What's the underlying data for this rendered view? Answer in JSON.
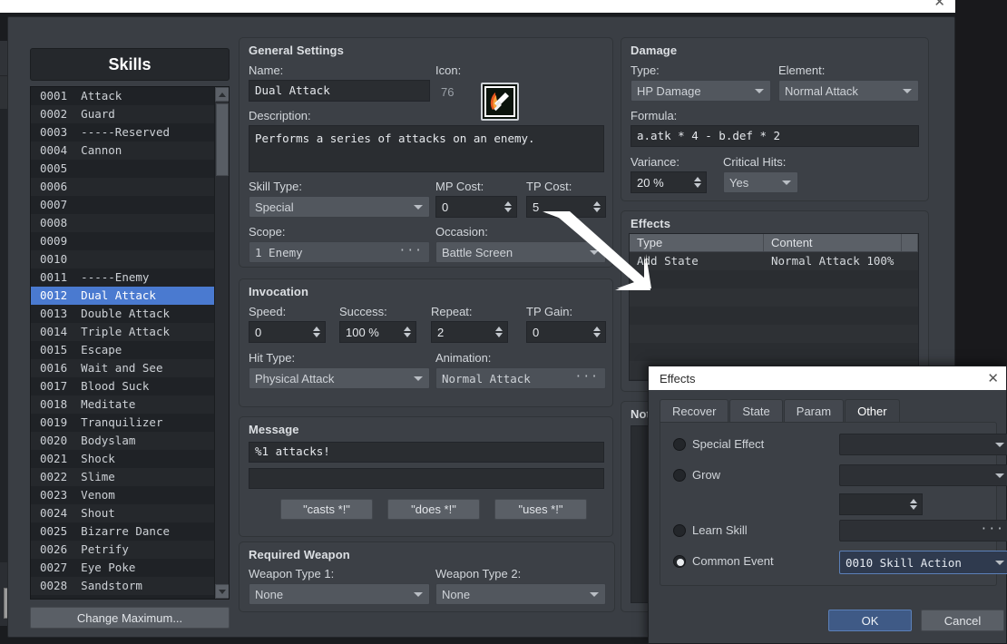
{
  "window": {
    "title_close": "✕",
    "skills_header": "Skills",
    "change_maximum": "Change Maximum..."
  },
  "skill_list": [
    {
      "id": "0001",
      "name": "Attack",
      "selected": false
    },
    {
      "id": "0002",
      "name": "Guard",
      "selected": false
    },
    {
      "id": "0003",
      "name": "-----Reserved",
      "selected": false
    },
    {
      "id": "0004",
      "name": "Cannon",
      "selected": false
    },
    {
      "id": "0005",
      "name": "",
      "selected": false
    },
    {
      "id": "0006",
      "name": "",
      "selected": false
    },
    {
      "id": "0007",
      "name": "",
      "selected": false
    },
    {
      "id": "0008",
      "name": "",
      "selected": false
    },
    {
      "id": "0009",
      "name": "",
      "selected": false
    },
    {
      "id": "0010",
      "name": "",
      "selected": false
    },
    {
      "id": "0011",
      "name": "-----Enemy",
      "selected": false
    },
    {
      "id": "0012",
      "name": "Dual Attack",
      "selected": true
    },
    {
      "id": "0013",
      "name": "Double Attack",
      "selected": false
    },
    {
      "id": "0014",
      "name": "Triple Attack",
      "selected": false
    },
    {
      "id": "0015",
      "name": "Escape",
      "selected": false
    },
    {
      "id": "0016",
      "name": "Wait and See",
      "selected": false
    },
    {
      "id": "0017",
      "name": "Blood Suck",
      "selected": false
    },
    {
      "id": "0018",
      "name": "Meditate",
      "selected": false
    },
    {
      "id": "0019",
      "name": "Tranquilizer",
      "selected": false
    },
    {
      "id": "0020",
      "name": "Bodyslam",
      "selected": false
    },
    {
      "id": "0021",
      "name": "Shock",
      "selected": false
    },
    {
      "id": "0022",
      "name": "Slime",
      "selected": false
    },
    {
      "id": "0023",
      "name": "Venom",
      "selected": false
    },
    {
      "id": "0024",
      "name": "Shout",
      "selected": false
    },
    {
      "id": "0025",
      "name": "Bizarre Dance",
      "selected": false
    },
    {
      "id": "0026",
      "name": "Petrify",
      "selected": false
    },
    {
      "id": "0027",
      "name": "Eye Poke",
      "selected": false
    },
    {
      "id": "0028",
      "name": "Sandstorm",
      "selected": false
    }
  ],
  "general": {
    "title": "General Settings",
    "name_label": "Name:",
    "name_value": "Dual Attack",
    "icon_label": "Icon:",
    "icon_index": "76",
    "description_label": "Description:",
    "description_value": "Performs a series of attacks on an enemy.",
    "skill_type_label": "Skill Type:",
    "skill_type_value": "Special",
    "mp_cost_label": "MP Cost:",
    "mp_cost_value": "0",
    "tp_cost_label": "TP Cost:",
    "tp_cost_value": "5",
    "scope_label": "Scope:",
    "scope_value": "1 Enemy",
    "occasion_label": "Occasion:",
    "occasion_value": "Battle Screen"
  },
  "invocation": {
    "title": "Invocation",
    "speed_label": "Speed:",
    "speed_value": "0",
    "success_label": "Success:",
    "success_value": "100 %",
    "repeat_label": "Repeat:",
    "repeat_value": "2",
    "tp_gain_label": "TP Gain:",
    "tp_gain_value": "0",
    "hit_type_label": "Hit Type:",
    "hit_type_value": "Physical Attack",
    "animation_label": "Animation:",
    "animation_value": "Normal Attack"
  },
  "message": {
    "title": "Message",
    "line1": "%1 attacks!",
    "line2": "",
    "preset1": "\"casts *!\"",
    "preset2": "\"does *!\"",
    "preset3": "\"uses *!\""
  },
  "required_weapon": {
    "title": "Required Weapon",
    "type1_label": "Weapon Type 1:",
    "type1_value": "None",
    "type2_label": "Weapon Type 2:",
    "type2_value": "None"
  },
  "damage": {
    "title": "Damage",
    "type_label": "Type:",
    "type_value": "HP Damage",
    "element_label": "Element:",
    "element_value": "Normal Attack",
    "formula_label": "Formula:",
    "formula_value": "a.atk * 4 - b.def * 2",
    "variance_label": "Variance:",
    "variance_value": "20 %",
    "critical_label": "Critical Hits:",
    "critical_value": "Yes"
  },
  "effects_panel": {
    "title": "Effects",
    "columns": [
      "Type",
      "Content",
      ""
    ],
    "rows": [
      [
        "Add State",
        "Normal Attack 100%"
      ]
    ]
  },
  "note_panel": {
    "title": "Note"
  },
  "effects_dialog": {
    "title": "Effects",
    "close": "✕",
    "tabs": [
      {
        "label": "Recover",
        "active": false
      },
      {
        "label": "State",
        "active": false
      },
      {
        "label": "Param",
        "active": false
      },
      {
        "label": "Other",
        "active": true
      }
    ],
    "options": [
      {
        "label": "Special Effect",
        "selected": false,
        "value": ""
      },
      {
        "label": "Grow",
        "selected": false,
        "value": ""
      },
      {
        "label": "Learn Skill",
        "selected": false,
        "value": ""
      },
      {
        "label": "Common Event",
        "selected": true,
        "value": "0010 Skill Action"
      }
    ],
    "grow_amount": "",
    "ok_label": "OK",
    "cancel_label": "Cancel"
  },
  "colors": {
    "selection_blue": "#4a7ad0",
    "panel_bg": "#3c4046",
    "window_bg": "#3a3e44",
    "field_bg": "#2a2d31",
    "accent_focus": "#5b80b8"
  }
}
